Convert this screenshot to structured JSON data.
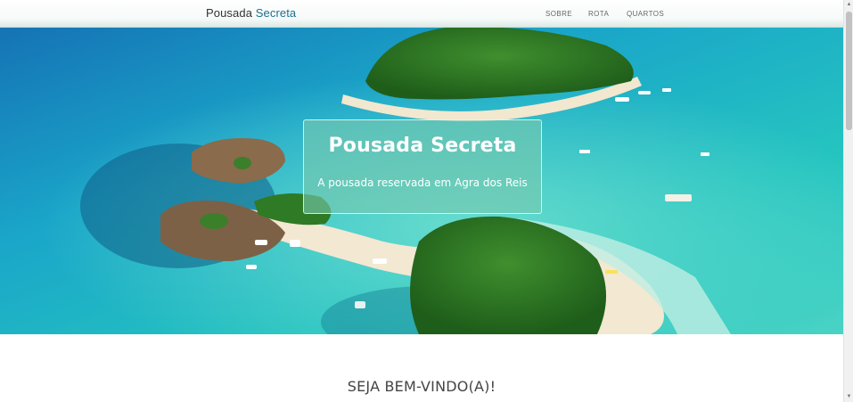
{
  "navbar": {
    "brand_primary": "Pousada",
    "brand_accent": "Secreta",
    "links": [
      "SOBRE",
      "ROTA",
      "QUARTOS"
    ]
  },
  "hero": {
    "title": "Pousada Secreta",
    "subtitle": "A pousada reservada em Agra dos Reis"
  },
  "content": {
    "welcome_heading": "SEJA BEM-VINDO(A)!"
  },
  "colors": {
    "accent": "#1d6f8f",
    "sea": "#1fb9c6",
    "hero_box": "#78c8af"
  }
}
